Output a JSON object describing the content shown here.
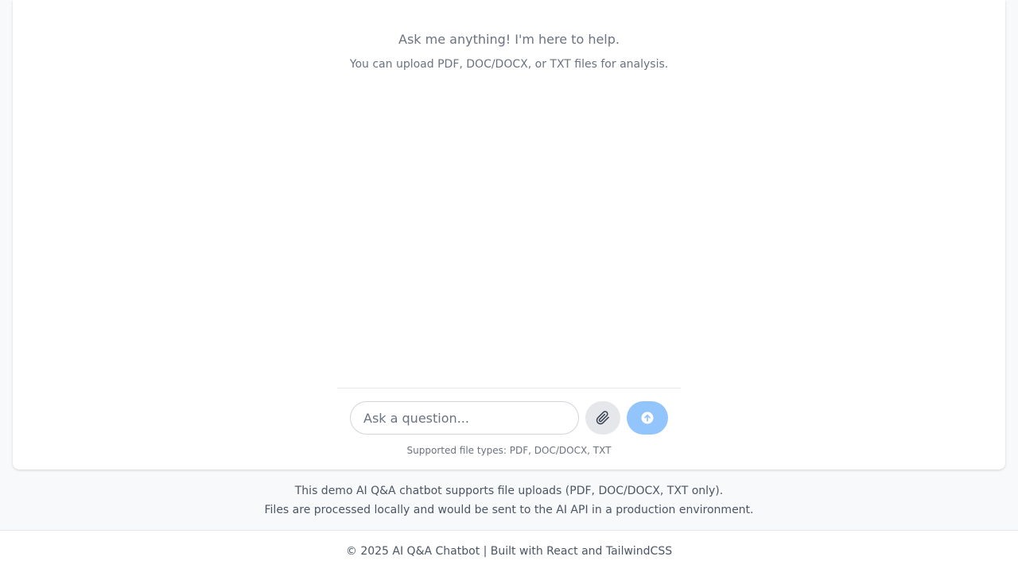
{
  "chat": {
    "welcome_title": "Ask me anything! I'm here to help.",
    "welcome_subtitle": "You can upload PDF, DOC/DOCX, or TXT files for analysis."
  },
  "composer": {
    "placeholder": "Ask a question...",
    "value": "",
    "attach_icon": "paperclip-icon",
    "send_icon": "arrow-up-circle-icon",
    "supported_types": "Supported file types: PDF, DOC/DOCX, TXT"
  },
  "info": {
    "line1": "This demo AI Q&A chatbot supports file uploads (PDF, DOC/DOCX, TXT only).",
    "line2": "Files are processed locally and would be sent to the AI API in a production environment."
  },
  "footer": {
    "text": "© 2025 AI Q&A Chatbot | Built with React and TailwindCSS"
  },
  "colors": {
    "send_button": "#93c5fd",
    "attach_button": "#e5e7eb",
    "page_background": "#f8f9fb"
  }
}
